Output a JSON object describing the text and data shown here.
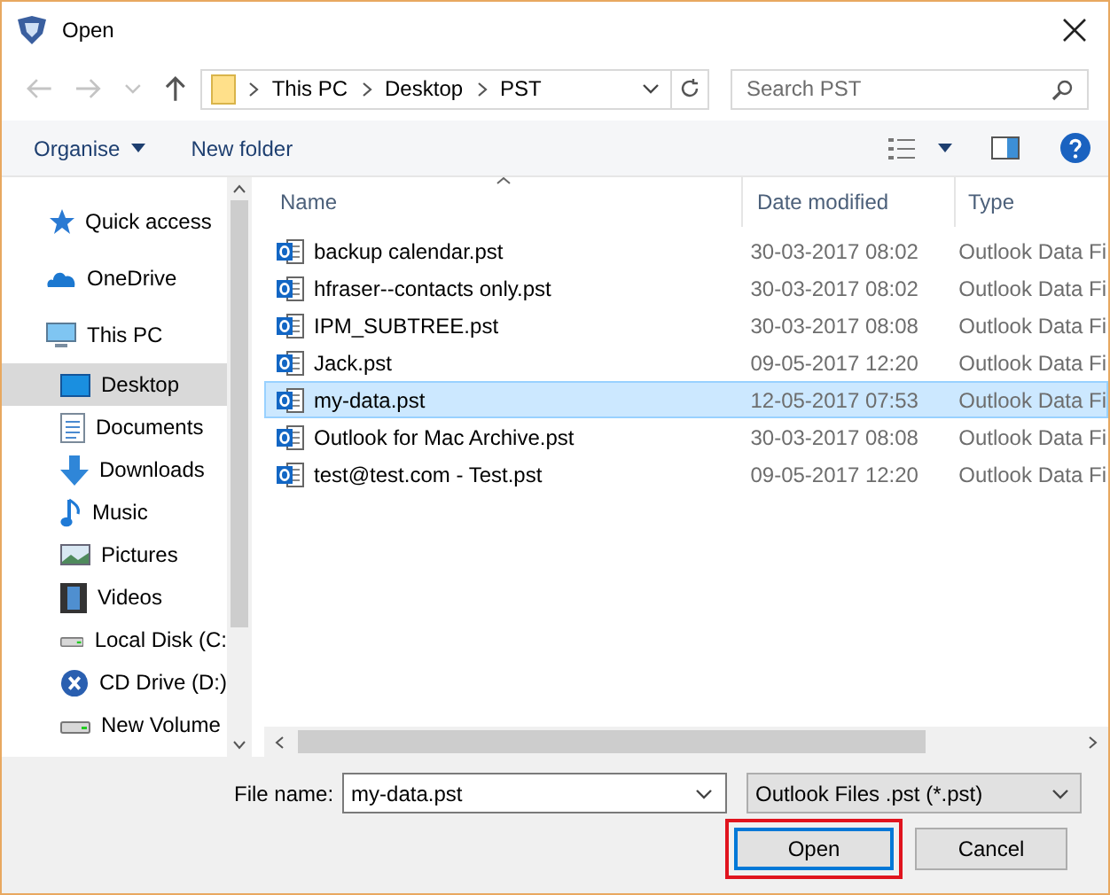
{
  "window": {
    "title": "Open"
  },
  "address": {
    "crumbs": [
      "This PC",
      "Desktop",
      "PST"
    ],
    "search_placeholder": "Search PST"
  },
  "toolbar": {
    "organise": "Organise",
    "new_folder": "New folder"
  },
  "sidebar": {
    "items": [
      {
        "label": "Quick access",
        "kind": "star",
        "selected": false
      },
      {
        "label": "OneDrive",
        "kind": "cloud",
        "selected": false
      },
      {
        "label": "This PC",
        "kind": "pc",
        "selected": false,
        "children": [
          {
            "label": "Desktop",
            "kind": "desktop",
            "selected": true
          },
          {
            "label": "Documents",
            "kind": "documents",
            "selected": false
          },
          {
            "label": "Downloads",
            "kind": "downloads",
            "selected": false
          },
          {
            "label": "Music",
            "kind": "music",
            "selected": false
          },
          {
            "label": "Pictures",
            "kind": "pictures",
            "selected": false
          },
          {
            "label": "Videos",
            "kind": "videos",
            "selected": false
          },
          {
            "label": "Local Disk (C:",
            "kind": "disk",
            "selected": false
          },
          {
            "label": "CD Drive (D:)",
            "kind": "cd",
            "selected": false
          },
          {
            "label": "New Volume",
            "kind": "disk",
            "selected": false
          }
        ]
      }
    ]
  },
  "table": {
    "columns": [
      "Name",
      "Date modified",
      "Type"
    ],
    "rows": [
      {
        "name": "backup calendar.pst",
        "date": "30-03-2017 08:02",
        "type": "Outlook Data Fi",
        "selected": false
      },
      {
        "name": "hfraser--contacts only.pst",
        "date": "30-03-2017 08:02",
        "type": "Outlook Data Fi",
        "selected": false
      },
      {
        "name": "IPM_SUBTREE.pst",
        "date": "30-03-2017 08:08",
        "type": "Outlook Data Fi",
        "selected": false
      },
      {
        "name": "Jack.pst",
        "date": "09-05-2017 12:20",
        "type": "Outlook Data Fi",
        "selected": false
      },
      {
        "name": "my-data.pst",
        "date": "12-05-2017 07:53",
        "type": "Outlook Data Fi",
        "selected": true
      },
      {
        "name": "Outlook for Mac Archive.pst",
        "date": "30-03-2017 08:08",
        "type": "Outlook Data Fi",
        "selected": false
      },
      {
        "name": "test@test.com - Test.pst",
        "date": "09-05-2017 12:20",
        "type": "Outlook Data Fi",
        "selected": false
      }
    ]
  },
  "footer": {
    "file_name_label": "File name:",
    "file_name": "my-data.pst",
    "filter": "Outlook Files .pst (*.pst)",
    "buttons": [
      {
        "label": "Open",
        "default": true,
        "highlighted": true
      },
      {
        "label": "Cancel",
        "default": false,
        "highlighted": false
      }
    ]
  }
}
